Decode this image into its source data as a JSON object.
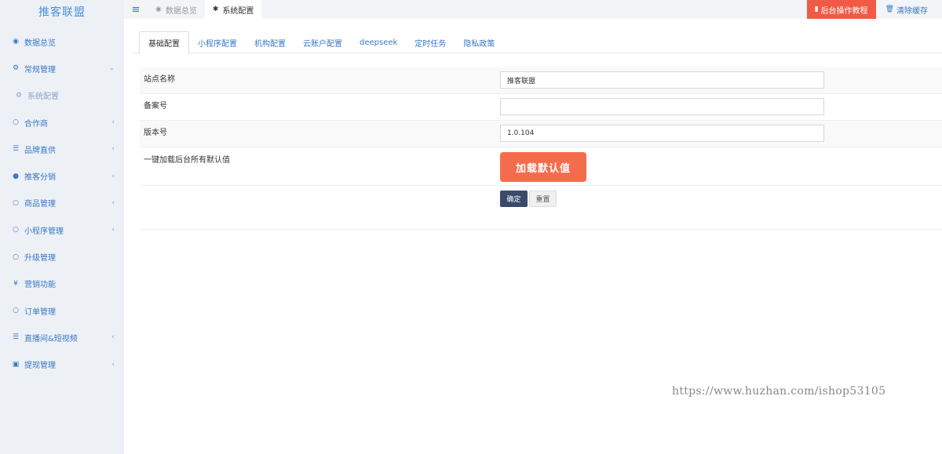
{
  "brand": "推客联盟",
  "sidebar": {
    "items": [
      {
        "label": "数据总览",
        "icon": "◉",
        "arrow": ""
      },
      {
        "label": "常规管理",
        "icon": "⚙",
        "arrow": "⌄"
      },
      {
        "label": "系统配置",
        "icon": "⚙",
        "arrow": ""
      },
      {
        "label": "合作商",
        "icon": "○",
        "arrow": "‹"
      },
      {
        "label": "品牌直供",
        "icon": "☰",
        "arrow": "‹"
      },
      {
        "label": "推客分销",
        "icon": "●",
        "arrow": "‹"
      },
      {
        "label": "商品管理",
        "icon": "○",
        "arrow": "‹"
      },
      {
        "label": "小程序管理",
        "icon": "○",
        "arrow": "‹"
      },
      {
        "label": "升级管理",
        "icon": "○",
        "arrow": ""
      },
      {
        "label": "营销功能",
        "icon": "¥",
        "arrow": ""
      },
      {
        "label": "订单管理",
        "icon": "○",
        "arrow": ""
      },
      {
        "label": "直播间&短视频",
        "icon": "☰",
        "arrow": "‹"
      },
      {
        "label": "提现管理",
        "icon": "▣",
        "arrow": "‹"
      }
    ]
  },
  "topbar": {
    "menu_icon": "≡",
    "tabs": [
      {
        "label": "数据总览",
        "icon": "◉"
      },
      {
        "label": "系统配置",
        "icon": "✱"
      }
    ],
    "tutorial": {
      "label": "后台操作教程",
      "icon": "▮"
    },
    "clear_cache": {
      "label": "清除缓存",
      "icon": "🗑"
    }
  },
  "tabs": [
    "基础配置",
    "小程序配置",
    "机构配置",
    "云账户配置",
    "deepseek",
    "定时任务",
    "隐私政策"
  ],
  "form": {
    "site_name": {
      "label": "站点名称",
      "value": "推客联盟"
    },
    "icp": {
      "label": "备案号",
      "value": ""
    },
    "version": {
      "label": "版本号",
      "value": "1.0.104"
    },
    "load_defaults": {
      "label": "一键加载后台所有默认值",
      "button": "加载默认值"
    },
    "submit": "确定",
    "reset": "重置"
  },
  "watermark": "https://www.huzhan.com/ishop53105",
  "colors": {
    "accent": "#3a78c4",
    "danger": "#f15a45",
    "primary_dark": "#3b4a6b"
  }
}
